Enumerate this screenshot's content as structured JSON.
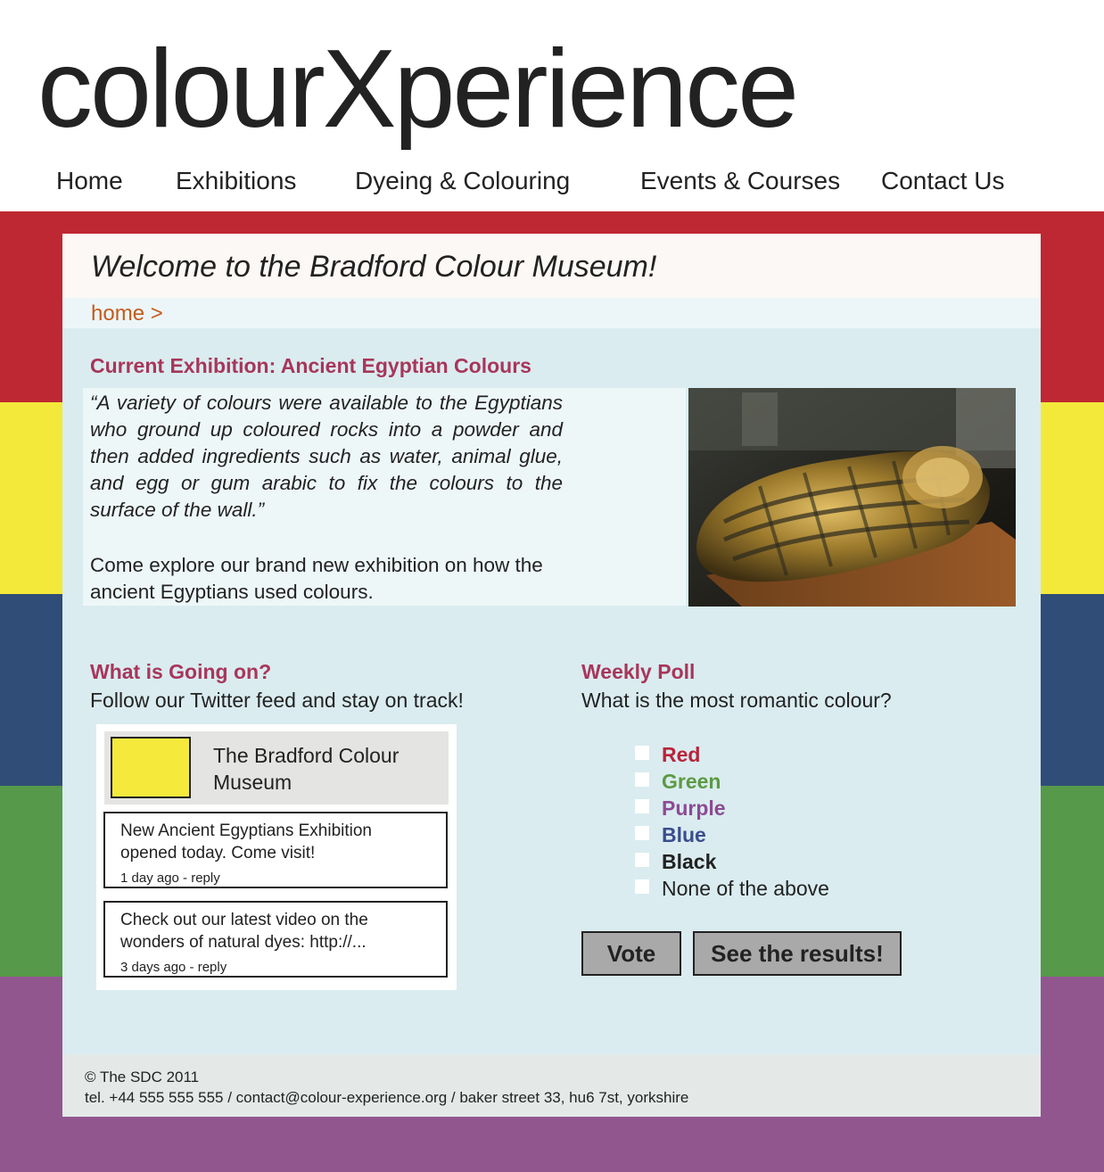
{
  "site": {
    "logo": "colourXperience"
  },
  "nav": {
    "items": [
      {
        "label": "Home"
      },
      {
        "label": "Exhibitions"
      },
      {
        "label": "Dyeing & Colouring"
      },
      {
        "label": "Events & Courses"
      },
      {
        "label": "Contact Us"
      }
    ]
  },
  "stripes": [
    "#be2832",
    "#f3e93a",
    "#2f4d77",
    "#56994a",
    "#92568f"
  ],
  "welcome": {
    "title": "Welcome to the Bradford Colour Museum!"
  },
  "breadcrumb": {
    "label": "home >"
  },
  "exhibition": {
    "heading": "Current Exhibition: Ancient Egyptian Colours",
    "quote": "“A variety of colours were available to the Egyptians who ground up coloured rocks into a powder and then added ingredients such as water, animal glue, and egg or gum arabic to fix the colours to the surface of the wall.”",
    "text": "Come explore our brand new exhibition on how the ancient Egyptians used colours.",
    "image": "egyptian-sarcophagus-photo"
  },
  "news": {
    "heading": "What is Going on?",
    "subtitle": "Follow our Twitter feed and stay on track!",
    "account_name": "The Bradford Colour Museum",
    "tweets": [
      {
        "text": "New Ancient Egyptians Exhibition opened today. Come visit!",
        "meta": "1 day ago - reply"
      },
      {
        "text": "Check out our latest video on the wonders of natural dyes: http://...",
        "meta": "3 days ago - reply"
      }
    ]
  },
  "poll": {
    "heading": "Weekly Poll",
    "question": "What is the most romantic colour?",
    "options": [
      {
        "label": "Red",
        "color": "#b8243a"
      },
      {
        "label": "Green",
        "color": "#5c9a42"
      },
      {
        "label": "Purple",
        "color": "#8d4a94"
      },
      {
        "label": "Blue",
        "color": "#3a4d8c"
      },
      {
        "label": "Black",
        "color": "#222222"
      },
      {
        "label": "None of the above",
        "color": "#222222"
      }
    ],
    "vote_label": "Vote",
    "results_label": "See the results!"
  },
  "footer": {
    "copyright": "© The SDC 2011",
    "contact": "tel. +44 555 555 555 / contact@colour-experience.org / baker street 33, hu6 7st, yorkshire"
  }
}
